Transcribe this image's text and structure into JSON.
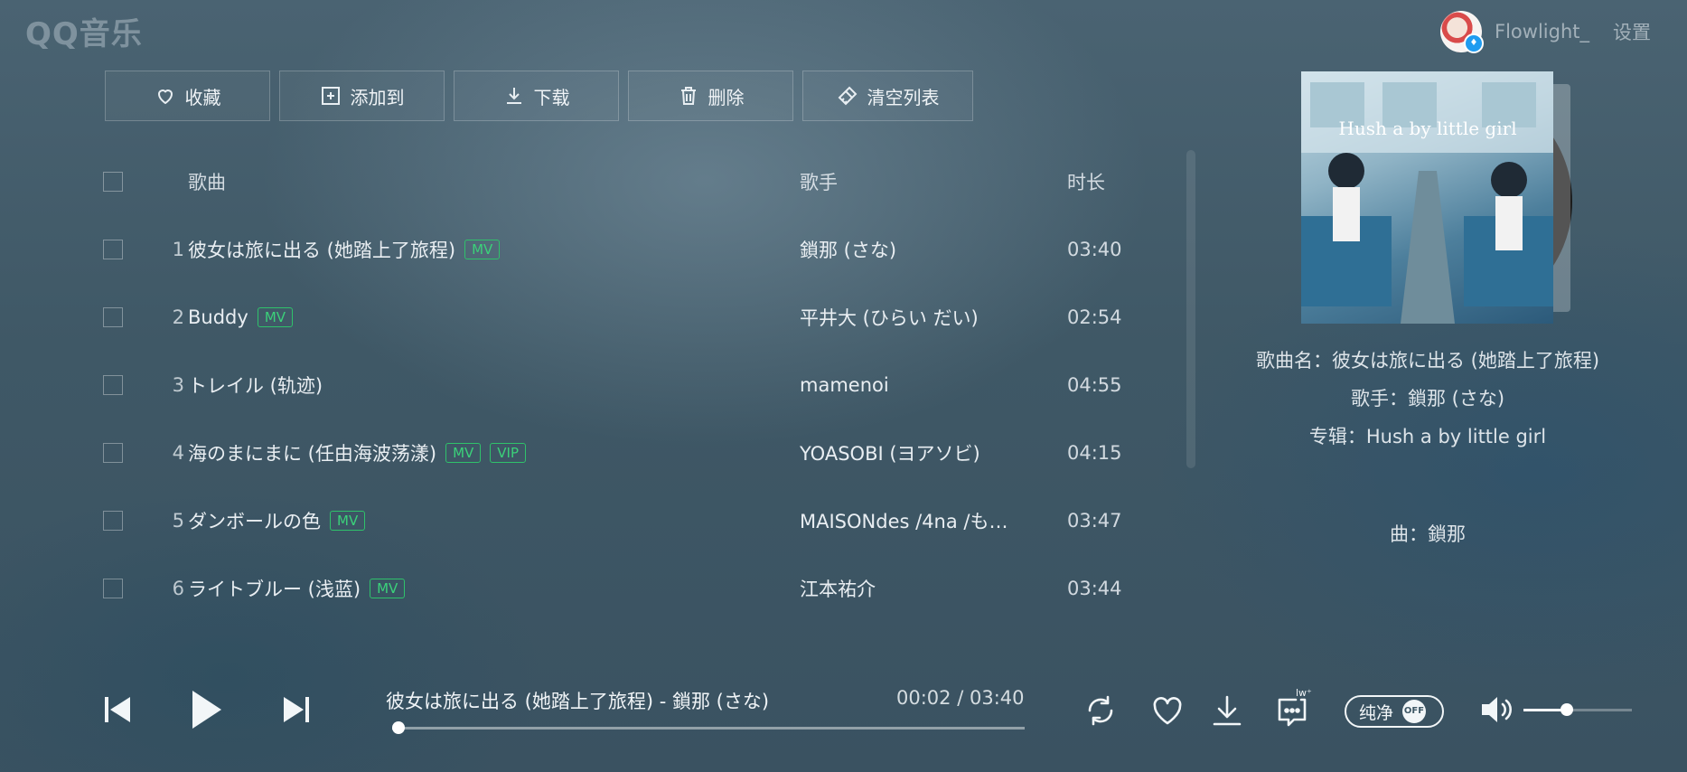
{
  "app": {
    "logo": "QQ音乐"
  },
  "user": {
    "name": "Flowlight_",
    "settings_label": "设置"
  },
  "toolbar": {
    "favorite": "收藏",
    "add_to": "添加到",
    "download": "下载",
    "delete": "删除",
    "clear_list": "清空列表"
  },
  "table": {
    "headers": {
      "song": "歌曲",
      "artist": "歌手",
      "duration": "时长"
    },
    "rows": [
      {
        "index": "1",
        "title": "彼女は旅に出る (她踏上了旅程)",
        "badges": [
          "MV"
        ],
        "artist": "鎖那 (さな)",
        "duration": "03:40"
      },
      {
        "index": "2",
        "title": "Buddy",
        "badges": [
          "MV"
        ],
        "artist": "平井大 (ひらい だい)",
        "duration": "02:54"
      },
      {
        "index": "3",
        "title": "トレイル (轨迹)",
        "badges": [],
        "artist": "mamenoi",
        "duration": "04:55"
      },
      {
        "index": "4",
        "title": "海のまにまに (任由海波荡漾)",
        "badges": [
          "MV",
          "VIP"
        ],
        "artist": "YOASOBI (ヨアソビ)",
        "duration": "04:15"
      },
      {
        "index": "5",
        "title": "ダンボールの色",
        "badges": [
          "MV"
        ],
        "artist": "MAISONdes /4na /も…",
        "duration": "03:47"
      },
      {
        "index": "6",
        "title": "ライトブルー (浅蓝)",
        "badges": [
          "MV"
        ],
        "artist": "江本祐介",
        "duration": "03:44"
      }
    ]
  },
  "now_playing_info": {
    "song_name": "歌曲名：彼女は旅に出る (她踏上了旅程)",
    "artist": "歌手：鎖那 (さな)",
    "album": "专辑：Hush a by little girl",
    "composer": "曲：鎖那",
    "cover_text": "Hush a by little girl"
  },
  "player": {
    "track": "彼女は旅に出る (她踏上了旅程) - 鎖那 (さな)",
    "elapsed": "00:02",
    "separator": "/",
    "total": "03:40",
    "progress": 0.01,
    "volume": 0.4,
    "pure_mode_label": "纯净",
    "pure_mode_state": "OFF",
    "lyric_badge": "lw⁺"
  },
  "colors": {
    "accent_green": "#2fc26b",
    "vip_blue": "#1f9cf0"
  }
}
